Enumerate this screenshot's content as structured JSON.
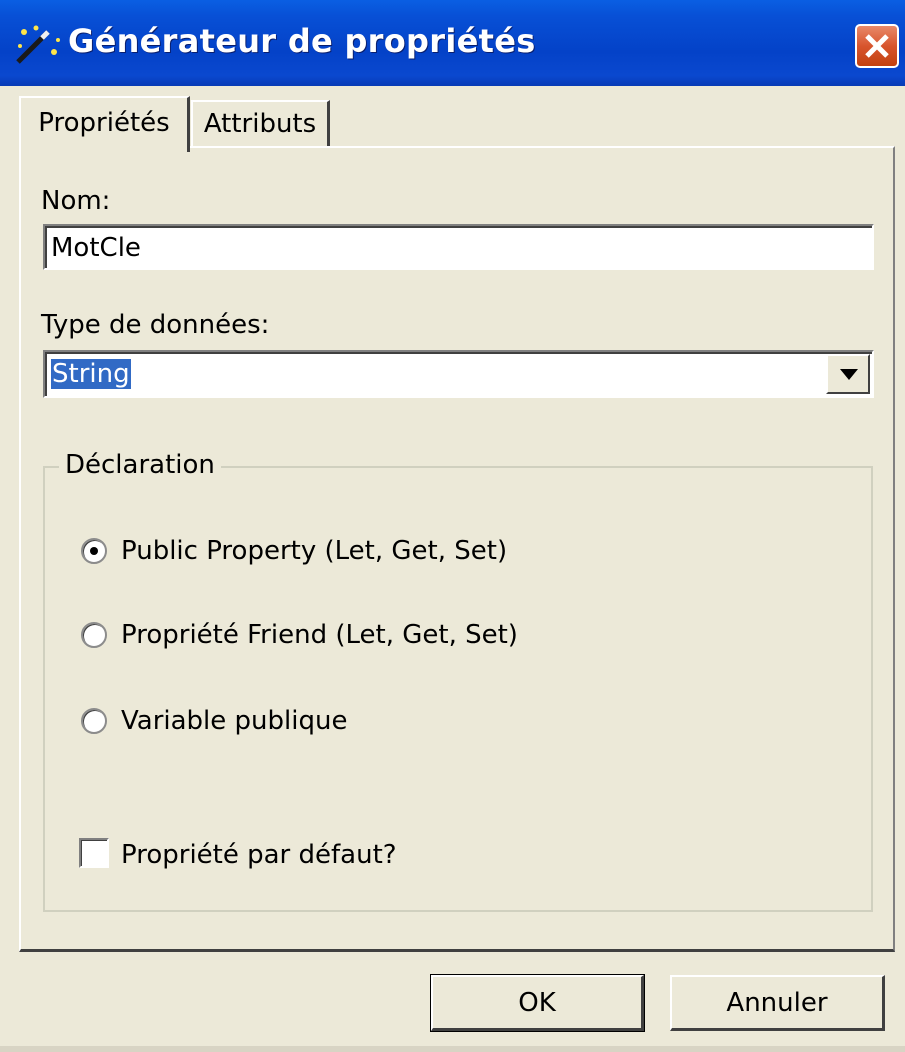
{
  "window": {
    "title": "Générateur de propriétés",
    "icon": "magic-wand-icon",
    "close_icon": "close-icon"
  },
  "tabs": [
    {
      "label": "Propriétés",
      "selected": true
    },
    {
      "label": "Attributs",
      "selected": false
    }
  ],
  "form": {
    "name_label": "Nom:",
    "name_value": "MotCle",
    "type_label": "Type de données:",
    "type_value": "String"
  },
  "declaration": {
    "title": "Déclaration",
    "options": [
      {
        "label": "Public Property (Let, Get, Set)",
        "selected": true
      },
      {
        "label": "Propriété Friend (Let, Get, Set)",
        "selected": false
      },
      {
        "label": "Variable publique",
        "selected": false
      }
    ],
    "default_label": "Propriété par défaut?",
    "default_checked": false
  },
  "buttons": {
    "ok": "OK",
    "cancel": "Annuler"
  },
  "colors": {
    "titlebar": "#0442c8",
    "window_bg": "#ece9d8",
    "close_button": "#d8552d",
    "selection": "#316ac5"
  }
}
